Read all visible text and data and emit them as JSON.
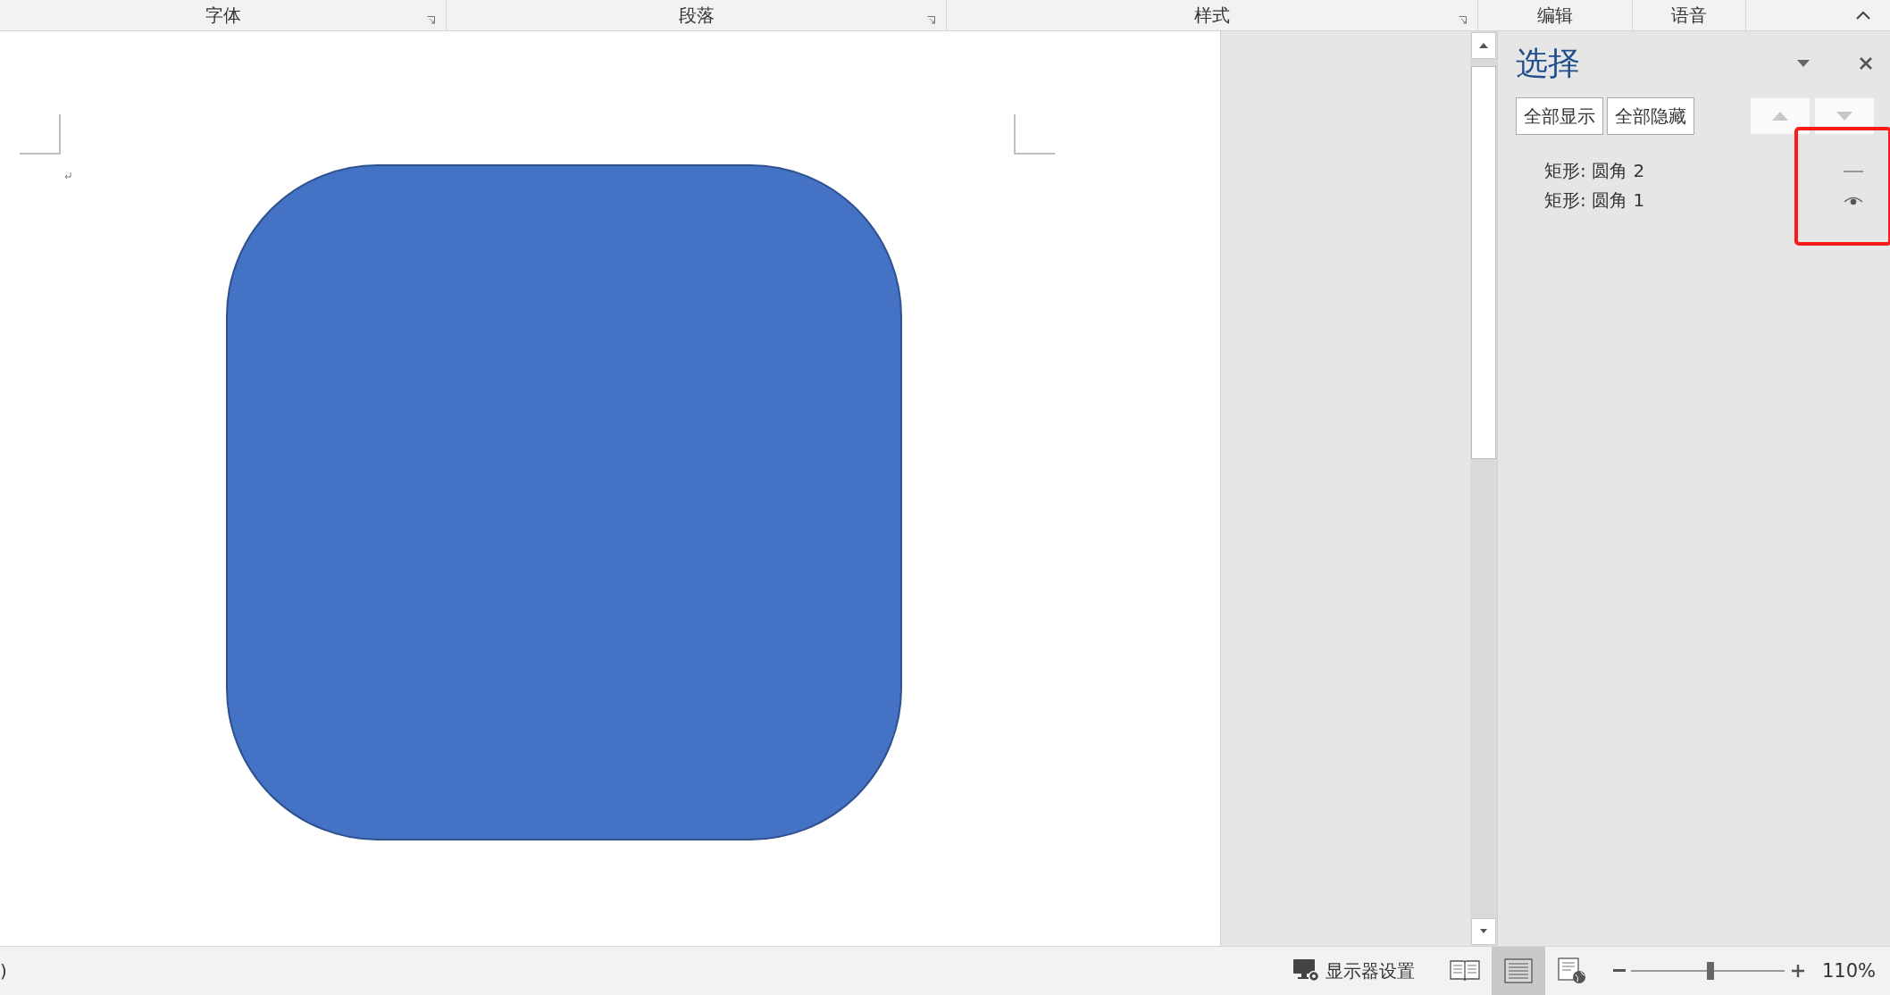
{
  "ribbon_groups": [
    {
      "label": "字体",
      "launcher": true
    },
    {
      "label": "段落",
      "launcher": true
    },
    {
      "label": "样式",
      "launcher": true
    },
    {
      "label": "编辑",
      "launcher": false
    },
    {
      "label": "语音",
      "launcher": false
    }
  ],
  "selection_pane": {
    "title": "选择",
    "buttons": [
      "全部显示",
      "全部隐藏"
    ],
    "items": [
      {
        "label": "矩形: 圆角 2",
        "visible": false
      },
      {
        "label": "矩形: 圆角 1",
        "visible": true
      }
    ]
  },
  "status_bar": {
    "left_text": ")",
    "display_settings": "显示器设置",
    "views": [
      {
        "kind": "read",
        "selected": false
      },
      {
        "kind": "print",
        "selected": true
      },
      {
        "kind": "web",
        "selected": false
      }
    ],
    "zoom": {
      "level": 0.52,
      "reading": "110%"
    }
  }
}
